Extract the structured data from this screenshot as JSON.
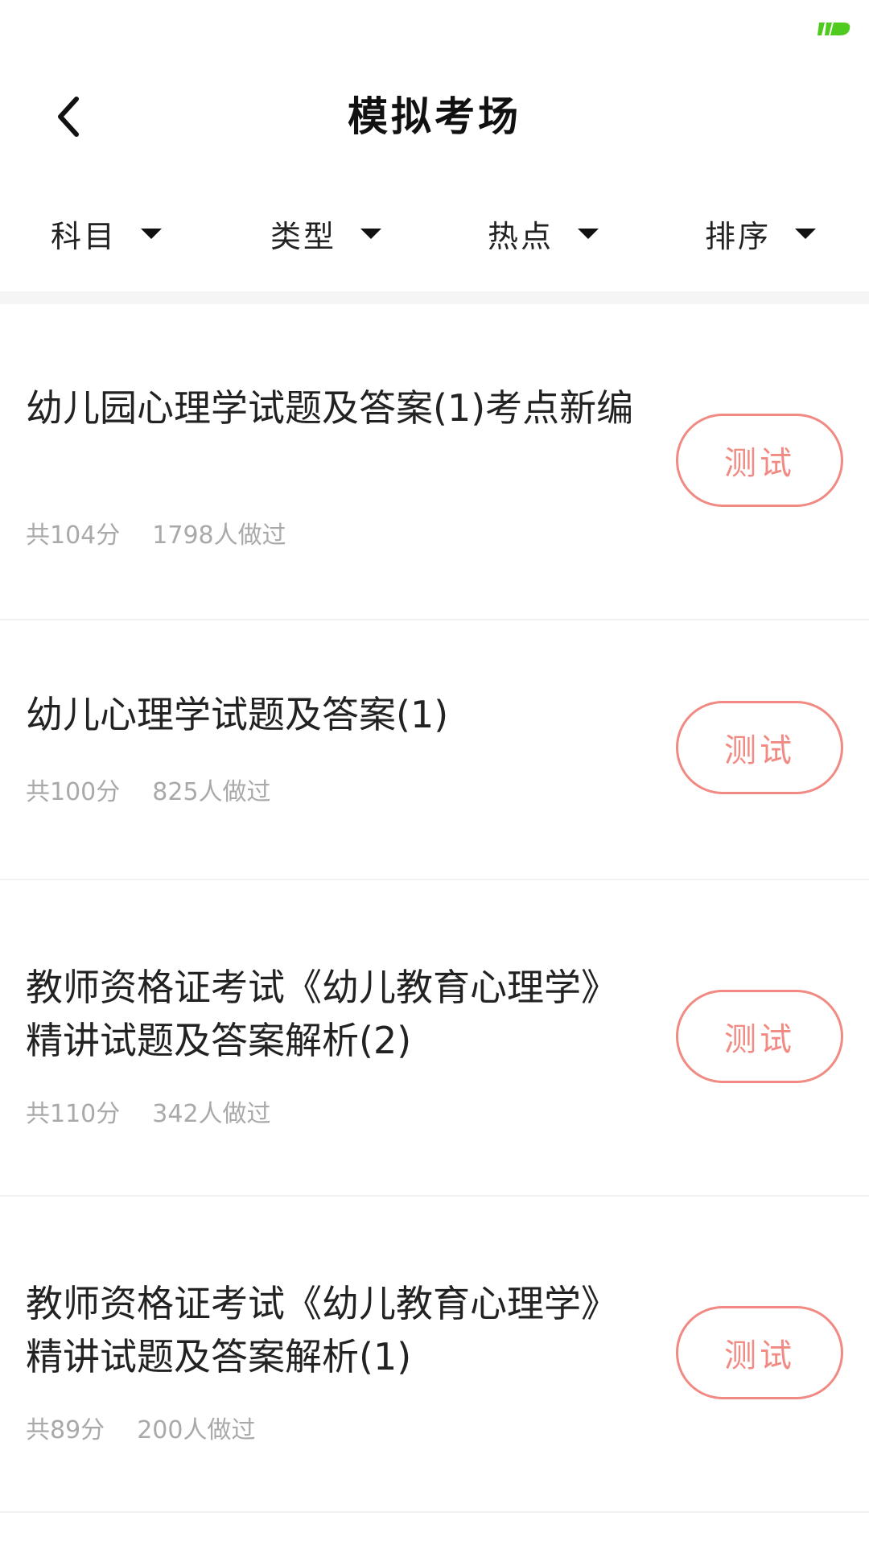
{
  "status_bar": {
    "logo_icon": "green-logo-icon",
    "logo_color": "#4ecb1e"
  },
  "header": {
    "back_icon": "chevron-left-icon",
    "title": "模拟考场"
  },
  "filters": [
    {
      "label": "科目",
      "icon": "caret-down-icon"
    },
    {
      "label": "类型",
      "icon": "caret-down-icon"
    },
    {
      "label": "热点",
      "icon": "caret-down-icon"
    },
    {
      "label": "排序",
      "icon": "caret-down-icon"
    }
  ],
  "exams": [
    {
      "title": "幼儿园心理学试题及答案(1)考点新编",
      "score": "共104分",
      "participants": "1798人做过",
      "button_label": "测试"
    },
    {
      "title": "幼儿心理学试题及答案(1)",
      "score": "共100分",
      "participants": "825人做过",
      "button_label": "测试"
    },
    {
      "title": "教师资格证考试《幼儿教育心理学》精讲试题及答案解析(2)",
      "score": "共110分",
      "participants": "342人做过",
      "button_label": "测试"
    },
    {
      "title": "教师资格证考试《幼儿教育心理学》精讲试题及答案解析(1)",
      "score": "共89分",
      "participants": "200人做过",
      "button_label": "测试"
    }
  ],
  "colors": {
    "accent": "#f08a83",
    "meta_text": "#a9a9a9",
    "separator": "#f5f5f5"
  }
}
